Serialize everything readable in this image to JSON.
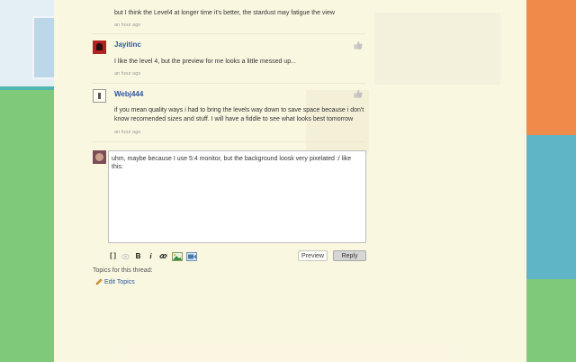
{
  "thread": {
    "comments": [
      {
        "text": "but I think the Level4 at longer time it's better, the stardust may fatigue the view",
        "time": "an hour ago"
      },
      {
        "user": "Jayitinc",
        "text": "I like the level 4, but the preview for me looks a little messed up...",
        "time": "an hour ago"
      },
      {
        "user": "Webj444",
        "line1": "if you mean quality ways i had to bring the levels way down to save space because i don't",
        "line2": "know recomended sizes and stuff. I will have a fiddle to see what looks best tomorrow",
        "time": "an hour ago"
      }
    ]
  },
  "reply": {
    "draft": "uhm, maybe because I use 5:4 monitor, but the background loosk very pixelated :/ like this:",
    "toolbar": {
      "code": "[ ]",
      "bold": "B",
      "italic": "i"
    },
    "preview_label": "Preview",
    "reply_label": "Reply"
  },
  "topics": {
    "label": "Topics for this thread:",
    "edit_label": "Edit Topics"
  },
  "icons": [
    "thumbs-up-icon",
    "code-icon",
    "eye-icon",
    "bold-icon",
    "italic-icon",
    "link-icon",
    "image-icon",
    "video-icon",
    "pencil-icon"
  ],
  "colors": {
    "username": "#2a55a3",
    "page_bg": "#fdf7e2"
  }
}
